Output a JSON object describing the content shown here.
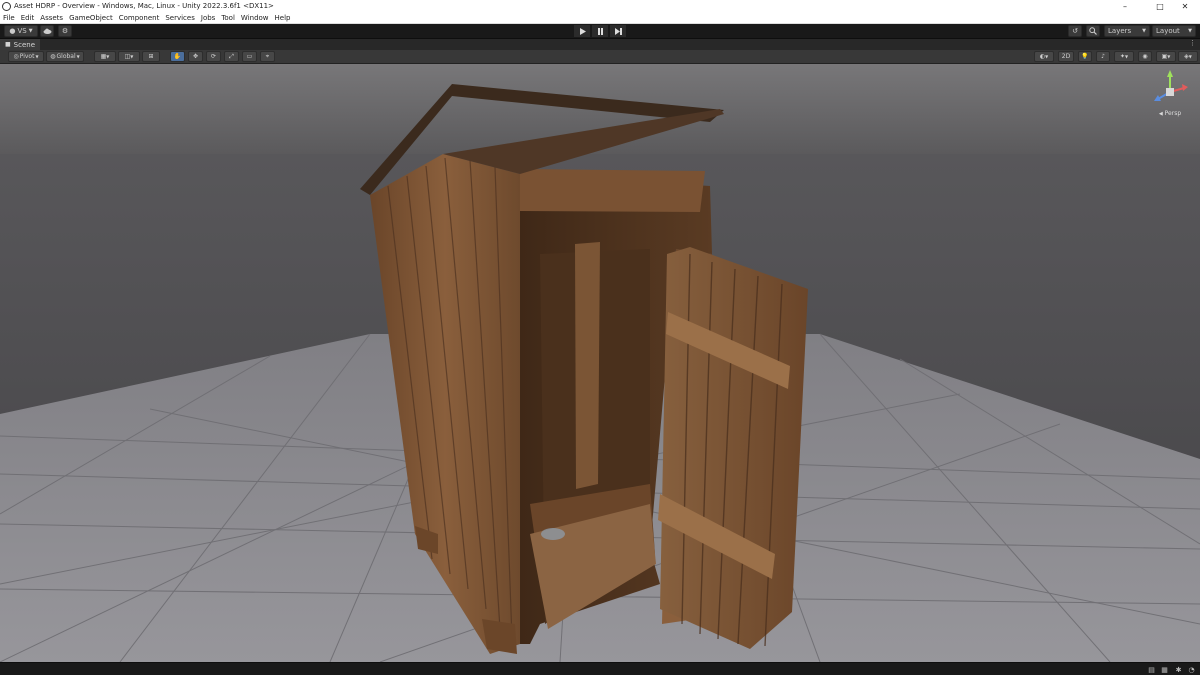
{
  "window": {
    "title": "Asset HDRP - Overview - Windows, Mac, Linux - Unity 2022.3.6f1 <DX11>",
    "minimize": "–",
    "maximize": "□",
    "close": "✕"
  },
  "menu": [
    "File",
    "Edit",
    "Assets",
    "GameObject",
    "Component",
    "Services",
    "Jobs",
    "Tool",
    "Window",
    "Help"
  ],
  "toolbar": {
    "account_label": "VS",
    "layers_label": "Layers",
    "layout_label": "Layout"
  },
  "scene_tab": {
    "label": "Scene"
  },
  "scene_toolbar": {
    "pivot_label": "Pivot",
    "global_label": "Global",
    "twod_label": "2D"
  },
  "gizmo": {
    "projection_label": "Persp"
  },
  "colors": {
    "editor_bg": "#191919",
    "toolbar_bg": "#383838",
    "active_tool": "#4b6e9c",
    "wood": "#7a5233",
    "floor": "#8e8e92",
    "sky": "#6d6c6e"
  },
  "icons": [
    "account-icon",
    "cloud-icon",
    "settings-icon",
    "play-icon",
    "pause-icon",
    "step-icon",
    "history-icon",
    "search-icon",
    "hand-tool-icon",
    "move-tool-icon",
    "rotate-tool-icon",
    "scale-tool-icon",
    "rect-tool-icon",
    "transform-tool-icon",
    "lighting-icon",
    "audio-icon",
    "effects-icon",
    "camera-icon",
    "gizmos-icon"
  ]
}
